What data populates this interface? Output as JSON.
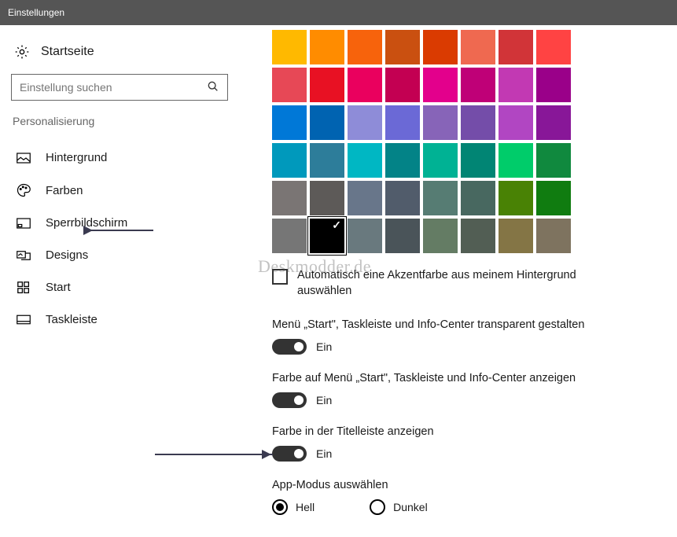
{
  "window": {
    "title": "Einstellungen"
  },
  "sidebar": {
    "home": "Startseite",
    "search_placeholder": "Einstellung suchen",
    "section": "Personalisierung",
    "items": [
      {
        "label": "Hintergrund"
      },
      {
        "label": "Farben"
      },
      {
        "label": "Sperrbildschirm"
      },
      {
        "label": "Designs"
      },
      {
        "label": "Start"
      },
      {
        "label": "Taskleiste"
      }
    ],
    "active_index": 1
  },
  "palette": {
    "colors": [
      "#FFB900",
      "#FF8C00",
      "#F7630C",
      "#CA5010",
      "#DA3B01",
      "#EF6950",
      "#D13438",
      "#FF4343",
      "#E74856",
      "#E81123",
      "#EA005E",
      "#C30052",
      "#E3008C",
      "#BF0077",
      "#C239B3",
      "#9A0089",
      "#0078D7",
      "#0063B1",
      "#8E8CD8",
      "#6B69D6",
      "#8764B8",
      "#744DA9",
      "#B146C2",
      "#881798",
      "#0099BC",
      "#2D7D9A",
      "#00B7C3",
      "#038387",
      "#00B294",
      "#018574",
      "#00CC6A",
      "#10893E",
      "#7A7574",
      "#5D5A58",
      "#68768A",
      "#515C6B",
      "#567C73",
      "#486860",
      "#498205",
      "#107C10",
      "#767676",
      "#000000",
      "#69797E",
      "#4A5459",
      "#647C64",
      "#525E54",
      "#847545",
      "#7E735F"
    ],
    "selected_index": 41
  },
  "settings": {
    "auto_accent": {
      "label": "Automatisch eine Akzentfarbe aus meinem Hintergrund auswählen",
      "checked": false
    },
    "transparent": {
      "label": "Menü „Start\", Taskleiste und Info-Center transparent gestalten",
      "state": "Ein",
      "on": true
    },
    "show_color_menu": {
      "label": "Farbe auf Menü „Start\", Taskleiste und Info-Center anzeigen",
      "state": "Ein",
      "on": true
    },
    "titlebar_color": {
      "label": "Farbe in der Titelleiste anzeigen",
      "state": "Ein",
      "on": true
    },
    "app_mode": {
      "label": "App-Modus auswählen",
      "options": [
        "Hell",
        "Dunkel"
      ],
      "selected": 0
    }
  },
  "watermark": "Deskmodder.de"
}
